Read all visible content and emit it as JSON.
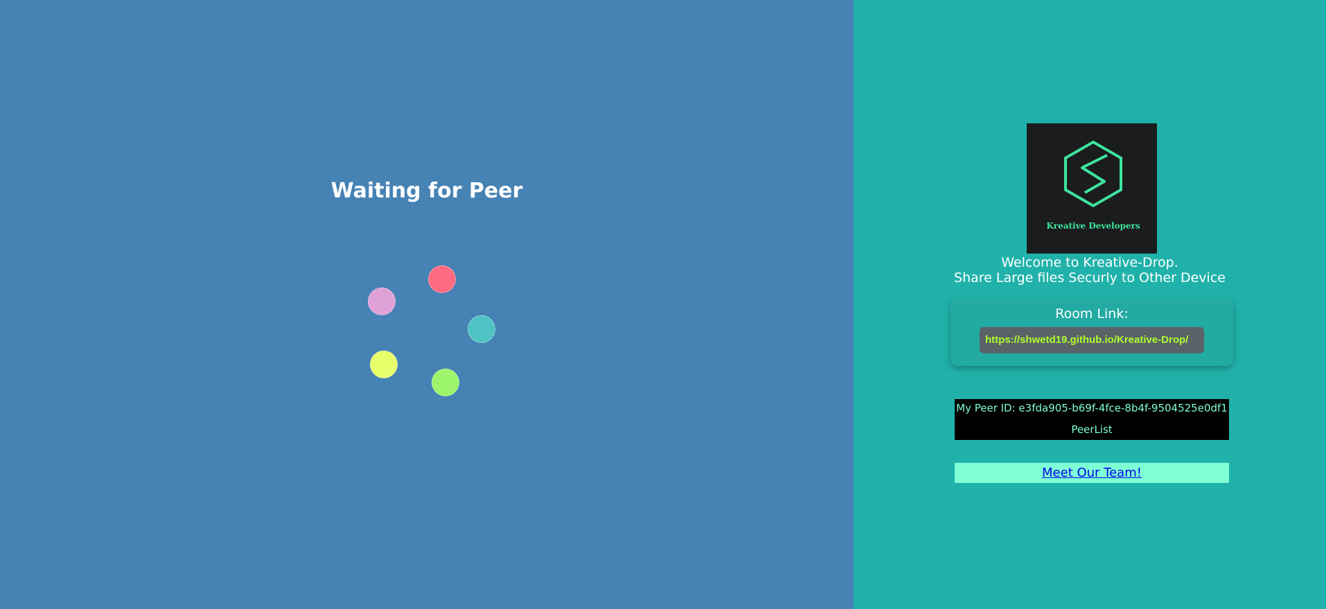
{
  "left_panel": {
    "title": "Waiting for Peer",
    "loader_dots": [
      {
        "name": "pink-red",
        "color": "#ff6b81"
      },
      {
        "name": "teal",
        "color": "#4fc3c3"
      },
      {
        "name": "green",
        "color": "#9cf56b"
      },
      {
        "name": "yellow",
        "color": "#e6ff6b"
      },
      {
        "name": "lavender",
        "color": "#e0a0d8"
      }
    ]
  },
  "right_panel": {
    "logo": {
      "text": "Kreative Developers",
      "icon": "hexagon-s-logo-icon",
      "accent": "#3ee59f"
    },
    "welcome_line1": "Welcome to Kreative-Drop.",
    "welcome_line2": "Share Large files Securly to Other Device",
    "room": {
      "label": "Room Link:",
      "link": "https://shwetd19.github.io/Kreative-Drop/"
    },
    "peer": {
      "id_text": "My Peer ID: e3fda905-b69f-4fce-8b4f-9504525e0df1",
      "list_label": "PeerList"
    },
    "team_link": "Meet Our Team!"
  },
  "colors": {
    "left_background": "#4682b4",
    "right_background": "#20b2aa",
    "peer_box_background": "#000000",
    "peer_text": "#7fffd4",
    "link_text": "#adff2f"
  }
}
